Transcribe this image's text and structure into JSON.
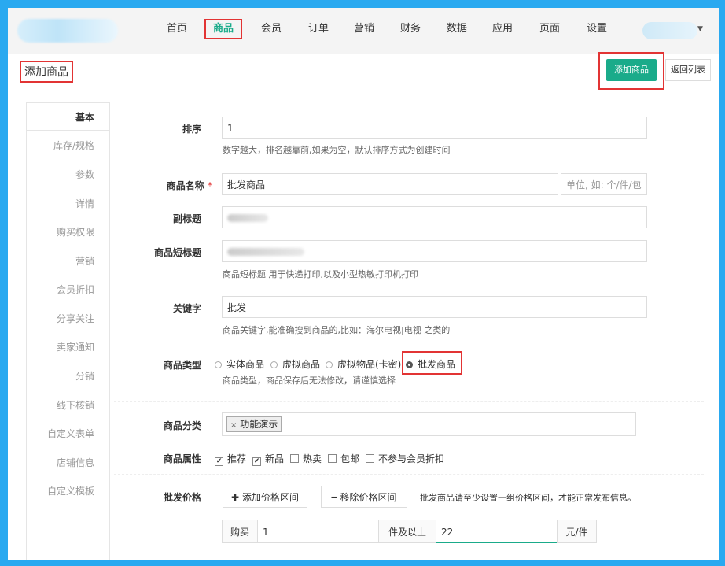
{
  "nav": {
    "items": [
      "首页",
      "商品",
      "会员",
      "订单",
      "营销",
      "财务",
      "数据",
      "应用",
      "页面",
      "设置"
    ],
    "active": "商品"
  },
  "header": {
    "title": "添加商品",
    "add_button": "添加商品",
    "back_button": "返回列表"
  },
  "sidebar": {
    "items": [
      "基本",
      "库存/规格",
      "参数",
      "详情",
      "购买权限",
      "营销",
      "会员折扣",
      "分享关注",
      "卖家通知",
      "分销",
      "线下核销",
      "自定义表单",
      "店铺信息",
      "自定义模板"
    ],
    "active": "基本"
  },
  "form": {
    "sort": {
      "label": "排序",
      "value": "1",
      "hint": "数字越大，排名越靠前,如果为空，默认排序方式为创建时间"
    },
    "name": {
      "label": "商品名称",
      "required_mark": "*",
      "value": "批发商品",
      "unit_placeholder": "单位, 如: 个/件/包"
    },
    "subtitle": {
      "label": "副标题"
    },
    "short_title": {
      "label": "商品短标题",
      "hint": "商品短标题 用于快递打印,以及小型热敏打印机打印"
    },
    "keywords": {
      "label": "关键字",
      "value": "批发",
      "hint": "商品关键字,能准确搜到商品的,比如：海尔电视|电视 之类的"
    },
    "type": {
      "label": "商品类型",
      "options": [
        "实体商品",
        "虚拟商品",
        "虚拟物品(卡密)",
        "批发商品"
      ],
      "selected": "批发商品",
      "hint": "商品类型，商品保存后无法修改，请谨慎选择"
    },
    "category": {
      "label": "商品分类",
      "tag": "功能演示",
      "tag_remove": "×"
    },
    "attributes": {
      "label": "商品属性",
      "items": [
        {
          "label": "推荐",
          "checked": "✔"
        },
        {
          "label": "新品",
          "checked": "✔"
        },
        {
          "label": "热卖",
          "checked": ""
        },
        {
          "label": "包邮",
          "checked": ""
        },
        {
          "label": "不参与会员折扣",
          "checked": ""
        }
      ]
    },
    "wholesale": {
      "label": "批发价格",
      "add_button": "添加价格区间",
      "remove_button": "移除价格区间",
      "notice": "批发商品请至少设置一组价格区间，才能正常发布信息。",
      "buy_label": "购买",
      "qty_value": "1",
      "qty_suffix": "件及以上",
      "price_value": "22",
      "price_suffix": "元/件"
    }
  }
}
